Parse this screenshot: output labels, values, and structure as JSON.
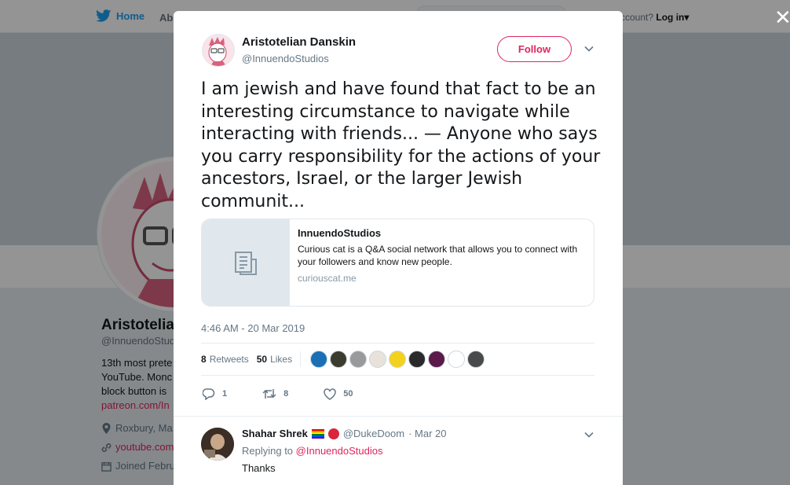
{
  "background": {
    "nav": {
      "home_label": "Home",
      "about_label": "Ab",
      "account_text": "ccount?",
      "login_label": "Log in"
    },
    "profile": {
      "name": "Aristotelian",
      "handle": "@InnuendoStud",
      "bio_lines": [
        "13th most prete",
        "YouTube. Monc",
        "block button is"
      ],
      "link": "patreon.com/In",
      "location": "Roxbury, Ma",
      "website": "youtube.com",
      "joined": "Joined Febru"
    }
  },
  "tweet": {
    "author_name": "Aristotelian Danskin",
    "author_handle": "@InnuendoStudios",
    "follow_label": "Follow",
    "text": "I am jewish and have found that fact to be an interesting circumstance to navigate while interacting with friends... — Anyone who says you carry responsibility for the actions of your ancestors, Israel, or the larger Jewish communit...",
    "card": {
      "title": "InnuendoStudios",
      "description": "Curious cat is a Q&A social network that allows you to connect with your followers and know new people.",
      "domain": "curiouscat.me"
    },
    "timestamp": "4:46 AM - 20 Mar 2019",
    "retweets_count": "8",
    "retweets_label": "Retweets",
    "likes_count": "50",
    "likes_label": "Likes",
    "liker_colors": [
      "#1b6fb5",
      "#3c3c2e",
      "#9a9a9a",
      "#e8e2da",
      "#f3d21f",
      "#2a2a2a",
      "#5a1a4a",
      "#ffffff",
      "#4a4a4a"
    ],
    "actions": {
      "reply_count": "1",
      "retweet_count": "8",
      "like_count": "50"
    }
  },
  "reply": {
    "author_name": "Shahar Shrek",
    "author_handle": "@DukeDoom",
    "date": "· Mar 20",
    "replying_prefix": "Replying to",
    "replying_to": "@InnuendoStudios",
    "text": "Thanks"
  },
  "colors": {
    "accent": "#e0245e",
    "twitter_blue": "#1da1f2",
    "muted": "#657786"
  }
}
